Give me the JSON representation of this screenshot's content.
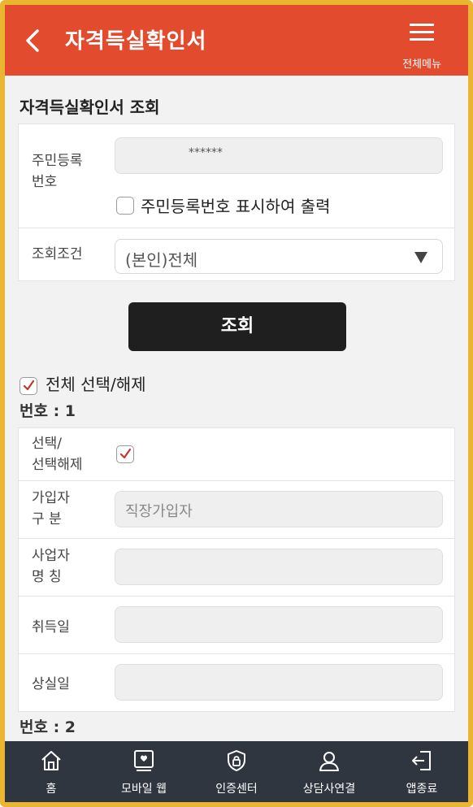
{
  "header": {
    "title": "자격득실확인서",
    "menu_label": "전체메뉴"
  },
  "section_title": "자격득실확인서 조회",
  "search": {
    "resident_number_label_line1": "주민등록",
    "resident_number_label_line2": "번호",
    "resident_number_value": "******",
    "show_number_checkbox_label": "주민등록번호 표시하여 출력",
    "condition_label": "조회조건",
    "condition_value": "(본인)전체",
    "search_button_label": "조회"
  },
  "select_all_label": "전체 선택/해제",
  "entries": [
    {
      "number_label": "번호 : 1",
      "select_label_line1": "선택/",
      "select_label_line2": "선택해제",
      "subscriber_label_line1": "가입자",
      "subscriber_label_line2": "구 분",
      "subscriber_type": "직장가입자",
      "business_label_line1": "사업자",
      "business_label_line2": "명 칭",
      "business_name": "",
      "acquisition_label": "취득일",
      "acquisition_date": "",
      "loss_label": "상실일",
      "loss_date": ""
    },
    {
      "number_label": "번호 : 2"
    }
  ],
  "bottom_nav": [
    {
      "label": "홈",
      "icon": "home-icon"
    },
    {
      "label": "모바일 웹",
      "icon": "mobile-web-icon"
    },
    {
      "label": "인증센터",
      "icon": "shield-lock-icon"
    },
    {
      "label": "상담사연결",
      "icon": "counselor-icon"
    },
    {
      "label": "앱종료",
      "icon": "exit-icon"
    }
  ],
  "colors": {
    "header": "#e34b2e",
    "frame": "#eab531",
    "nav": "#2f3640",
    "check": "#c0392b"
  }
}
